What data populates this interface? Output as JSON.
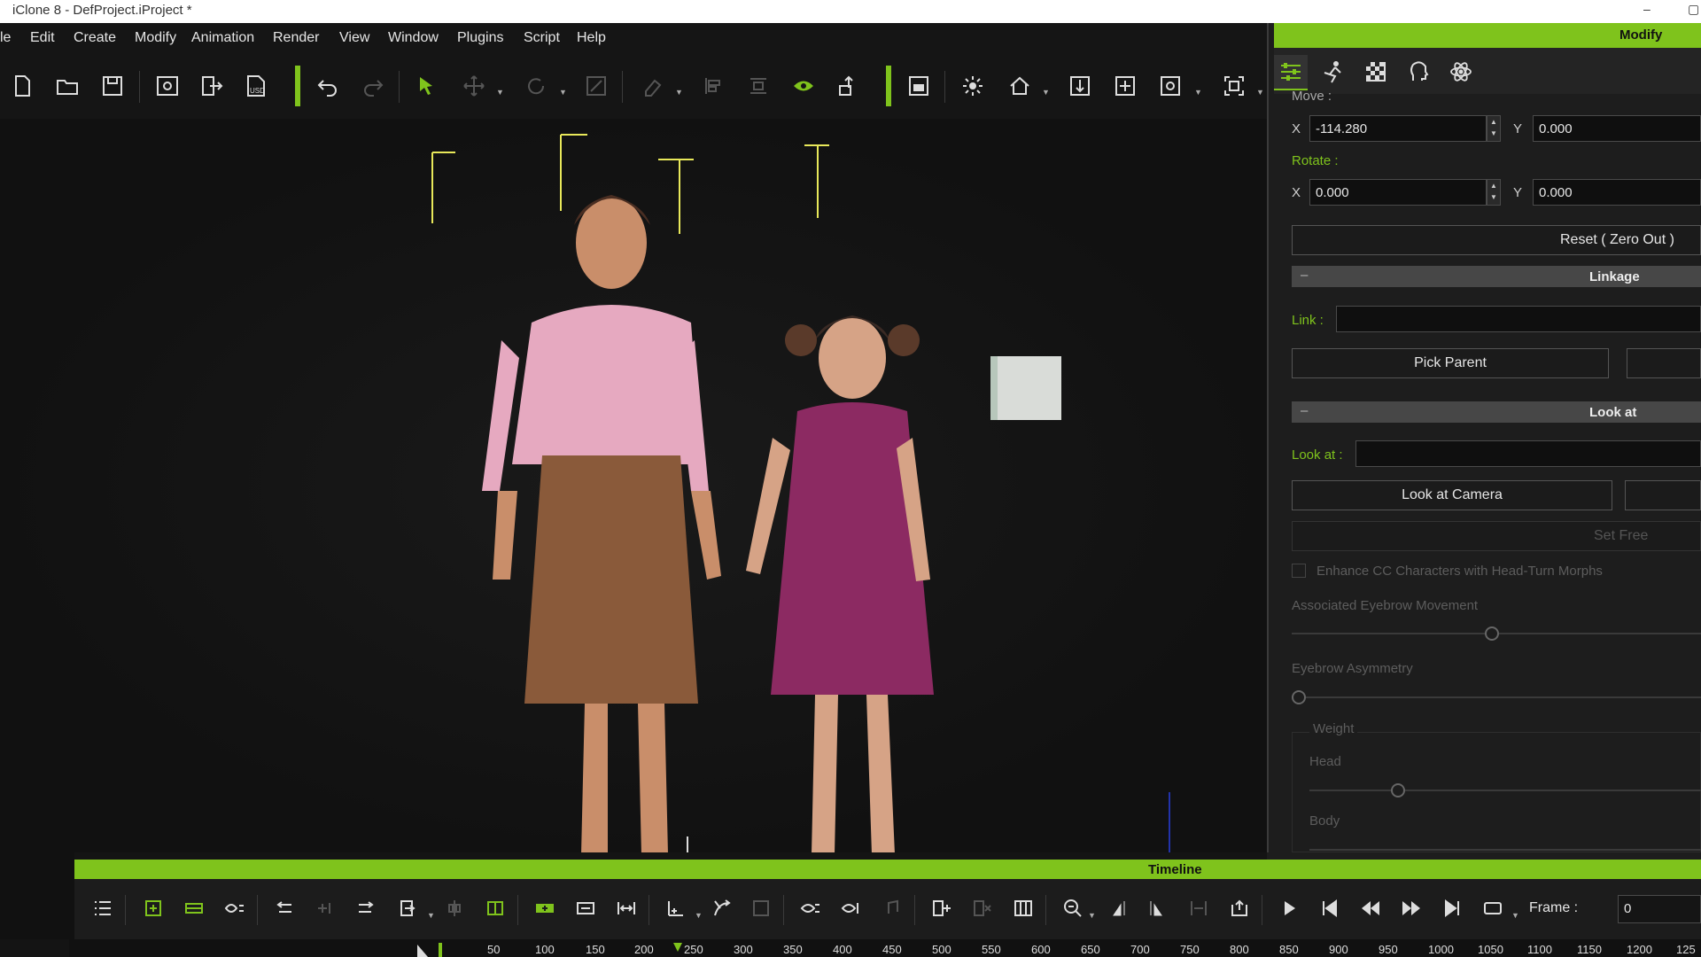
{
  "window": {
    "title": "iClone 8 - DefProject.iProject *"
  },
  "menu": [
    "le",
    "Edit",
    "Create",
    "Modify",
    "Animation",
    "Render",
    "View",
    "Window",
    "Plugins",
    "Script",
    "Help"
  ],
  "toolbar": {
    "icons": [
      "new-file-icon",
      "open-folder-icon",
      "save-icon",
      "preview-icon",
      "export-icon",
      "usd-export-icon",
      "undo-icon",
      "redo-icon",
      "select-arrow-icon",
      "move-icon",
      "rotate-icon",
      "scale-icon",
      "eraser-icon",
      "align-icon",
      "distribute-icon",
      "visibility-eye-icon",
      "place-icon",
      "layout-icon",
      "light-icon",
      "home-icon",
      "drop-to-floor-icon",
      "center-icon",
      "camera-link-icon",
      "frame-icon"
    ],
    "usd_label": "USD"
  },
  "panel": {
    "title": "Modify",
    "tabs": [
      "sliders-icon",
      "motion-icon",
      "material-icon",
      "head-icon",
      "physics-icon"
    ],
    "move_label": "Move :",
    "move": {
      "x_label": "X",
      "x": "-114.280",
      "y_label": "Y",
      "y": "0.000"
    },
    "rotate_label": "Rotate :",
    "rotate": {
      "x_label": "X",
      "x": "0.000",
      "y_label": "Y",
      "y": "0.000"
    },
    "reset_button": "Reset ( Zero Out )",
    "linkage": {
      "title": "Linkage",
      "link_label": "Link :",
      "link_value": "",
      "pick_parent": "Pick Parent"
    },
    "lookat": {
      "title": "Look at",
      "lookat_label": "Look at :",
      "lookat_value": "",
      "look_at_camera": "Look at Camera",
      "set_free": "Set Free",
      "enhance_checkbox": "Enhance CC Characters with Head-Turn Morphs",
      "eyebrow_movement": "Associated Eyebrow Movement",
      "eyebrow_asymmetry": "Eyebrow Asymmetry",
      "weight_label": "Weight",
      "head_label": "Head",
      "body_label": "Body"
    },
    "minus": "–"
  },
  "timeline": {
    "title": "Timeline",
    "frame_label": "Frame :",
    "frame_value": "0",
    "ruler": [
      "50",
      "100",
      "150",
      "200",
      "250",
      "300",
      "350",
      "400",
      "450",
      "500",
      "550",
      "600",
      "650",
      "700",
      "750",
      "800",
      "850",
      "900",
      "950",
      "1000",
      "1050",
      "1100",
      "1150",
      "1200",
      "125"
    ]
  },
  "colors": {
    "accent": "#7fc31c",
    "panel_bg": "#1d1d1d",
    "viewport_bg": "#111111"
  }
}
